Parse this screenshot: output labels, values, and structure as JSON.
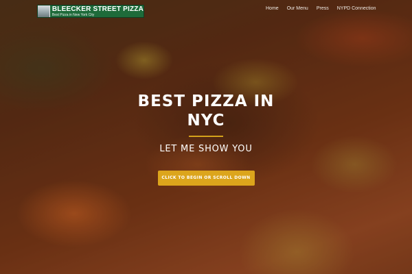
{
  "brand": {
    "title": "BLEECKER STREET PIZZA",
    "tagline": "Best Pizza in New York City"
  },
  "nav": {
    "items": [
      {
        "label": "Home"
      },
      {
        "label": "Our Menu"
      },
      {
        "label": "Press"
      },
      {
        "label": "NYPD Connection"
      }
    ]
  },
  "hero": {
    "headline": "BEST PIZZA IN NYC",
    "subheadline": "LET ME SHOW YOU",
    "cta_label": "CLICK TO BEGIN OR SCROLL DOWN"
  },
  "colors": {
    "accent": "#dca51c",
    "brand_green": "#1e6b3a",
    "text": "#ffffff"
  }
}
